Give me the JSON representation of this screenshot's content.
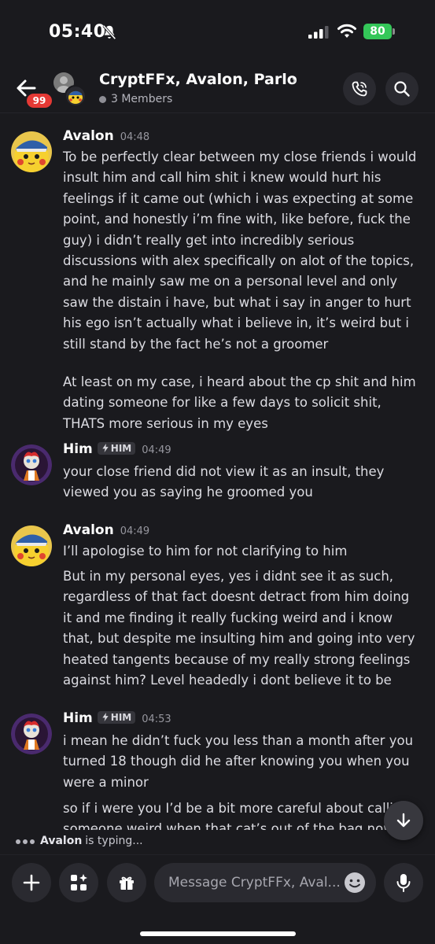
{
  "status_bar": {
    "time": "05:40",
    "battery": "80"
  },
  "header": {
    "title": "CryptFFx, Avalon, Parlo",
    "members": "3 Members",
    "badge": "99"
  },
  "messages": [
    {
      "author": "Avalon",
      "time": "04:48",
      "paragraphs": [
        "To be perfectly clear between my close friends i would insult him and call him shit i knew would hurt his feelings if it came out (which i was expecting at some point, and honestly i’m fine with, like before, fuck the guy) i didn’t really get into incredibly serious discussions with alex specifically on alot of the topics, and he mainly saw me on a personal level and only saw the distain i have, but what i say in anger to hurt his ego isn’t actually what i believe in, it’s weird but i still stand by the fact he’s not a groomer",
        "At least on my case, i heard about the cp shit and him dating someone for like a few days to solicit shit, THATS more serious in my eyes"
      ]
    },
    {
      "author": "Him",
      "tag": "HIM",
      "time": "04:49",
      "paragraphs": [
        "your close friend did not view it as an insult, they viewed you as saying he groomed you"
      ]
    },
    {
      "author": "Avalon",
      "time": "04:49",
      "paragraphs": [
        "I’ll apologise to him for not clarifying to him",
        "But in my personal eyes, yes i didnt see it as such, regardless of that fact doesnt detract from him doing it and me finding it really fucking weird and i know that, but despite me insulting him and going into very heated tangents because of my really strong feelings against him? Level headedly i dont believe it to be"
      ]
    },
    {
      "author": "Him",
      "tag": "HIM",
      "time": "04:53",
      "paragraphs": [
        "i mean he didn’t fuck you less than a month after you turned 18 though did he after knowing you when you were a minor",
        "so if i were you I’d be a bit more careful about calling someone weird when that cat’s out of the bag now"
      ]
    }
  ],
  "typing": {
    "name": "Avalon",
    "suffix": "is typing..."
  },
  "composer": {
    "placeholder": "Message CryptFFx, Aval..."
  },
  "colors": {
    "background": "#1a1a1e",
    "badge": "#e53935",
    "battery": "#34c759"
  },
  "icons": [
    "bell-off-icon",
    "signal-icon",
    "wifi-icon",
    "back-arrow-icon",
    "phone-icon",
    "search-icon",
    "plus-icon",
    "apps-icon",
    "gift-icon",
    "emoji-icon",
    "mic-icon",
    "arrow-down-icon",
    "bolt-icon"
  ]
}
